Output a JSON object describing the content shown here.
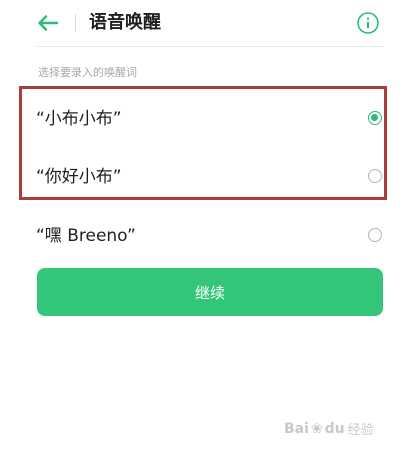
{
  "header": {
    "title": "语音唤醒",
    "back_icon": "arrow-left-icon",
    "info_icon": "info-icon"
  },
  "section_label": "选择要录入的唤醒词",
  "options": [
    {
      "label": "“小布小布”",
      "selected": true
    },
    {
      "label": "“你好小布”",
      "selected": false
    },
    {
      "label": "“嘿 Breeno”",
      "selected": false
    }
  ],
  "continue_label": "继续",
  "watermark": {
    "brand_a": "Bai",
    "brand_b": "du",
    "brand_c": "经验"
  },
  "colors": {
    "accent": "#2bbd77",
    "button": "#33c67a",
    "highlight": "#a83d3a"
  }
}
